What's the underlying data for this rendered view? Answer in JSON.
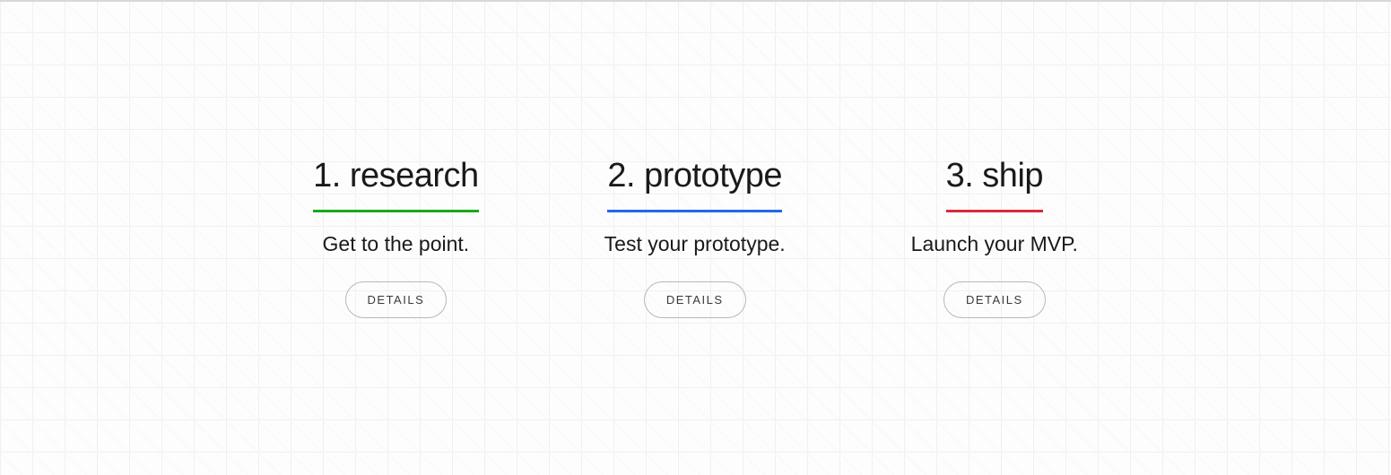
{
  "steps": [
    {
      "title": "1. research",
      "description": "Get to the point.",
      "button_label": "DETAILS",
      "accent_color": "#1aaa1a"
    },
    {
      "title": "2. prototype",
      "description": "Test your prototype.",
      "button_label": "DETAILS",
      "accent_color": "#2566e8"
    },
    {
      "title": "3. ship",
      "description": "Launch your MVP.",
      "button_label": "DETAILS",
      "accent_color": "#d92a3a"
    }
  ]
}
